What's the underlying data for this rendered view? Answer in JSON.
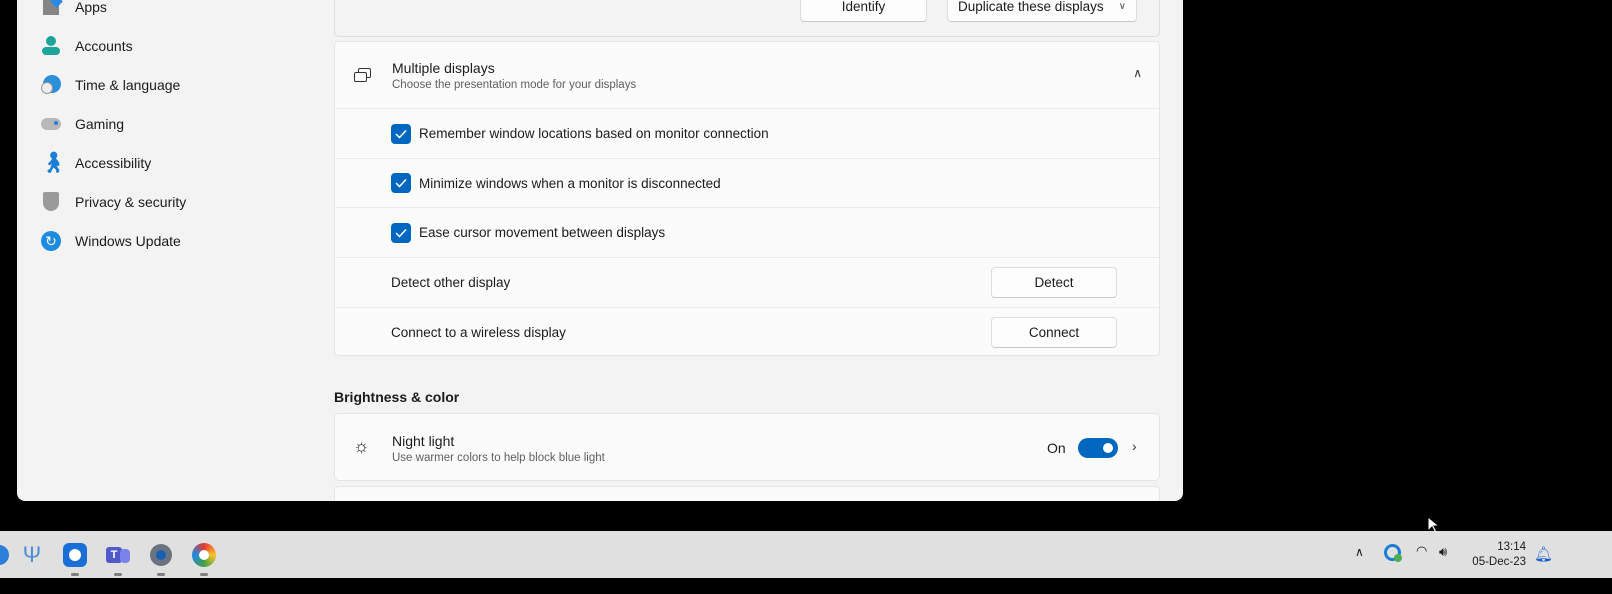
{
  "sidebar": {
    "items": [
      {
        "label": "Apps",
        "icon": "apps-icon"
      },
      {
        "label": "Accounts",
        "icon": "accounts-icon"
      },
      {
        "label": "Time & language",
        "icon": "time-language-icon"
      },
      {
        "label": "Gaming",
        "icon": "gaming-icon"
      },
      {
        "label": "Accessibility",
        "icon": "accessibility-icon"
      },
      {
        "label": "Privacy & security",
        "icon": "shield-icon"
      },
      {
        "label": "Windows Update",
        "icon": "windows-update-icon"
      }
    ]
  },
  "top": {
    "identify": "Identify",
    "duplicate": "Duplicate these displays"
  },
  "multiple": {
    "title": "Multiple displays",
    "subtitle": "Choose the presentation mode for your displays",
    "options": [
      {
        "label": "Remember window locations based on monitor connection",
        "checked": true
      },
      {
        "label": "Minimize windows when a monitor is disconnected",
        "checked": true
      },
      {
        "label": "Ease cursor movement between displays",
        "checked": true
      }
    ],
    "detect_label": "Detect other display",
    "detect_button": "Detect",
    "connect_label": "Connect to a wireless display",
    "connect_button": "Connect"
  },
  "brightness": {
    "heading": "Brightness & color",
    "night_title": "Night light",
    "night_sub": "Use warmer colors to help block blue light",
    "night_state": "On",
    "night_on": true
  },
  "taskbar": {
    "time": "13:14",
    "date": "05-Dec-23"
  },
  "colors": {
    "accent": "#0067c0"
  }
}
